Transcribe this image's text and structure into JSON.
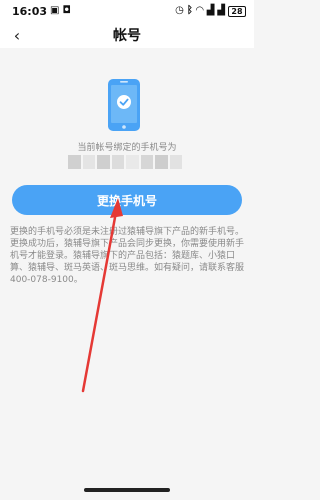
{
  "status_bar": {
    "time": "16:03",
    "battery": "28",
    "icons": [
      "notification-icon",
      "chat-bubble-icon",
      "alarm-icon",
      "bluetooth-icon",
      "wifi-icon",
      "signal-icon",
      "signal-icon",
      "battery-icon"
    ]
  },
  "nav": {
    "back_label": "‹",
    "title": "帐号"
  },
  "main": {
    "bind_label": "当前帐号绑定的手机号为",
    "masked_phone_colors": [
      "#d0d0d0",
      "#e4e4e4",
      "#cfcfcf",
      "#dcdcdc",
      "#e9e9e9",
      "#d6d6d6",
      "#cdcdcd",
      "#e2e2e2"
    ],
    "change_button_label": "更换手机号",
    "notice_text": "更换的手机号必须是未注册过猿辅导旗下产品的新手机号。更换成功后，猿辅导旗下产品会同步更换，你需要使用新手机号才能登录。猿辅导旗下的产品包括：猿题库、小猿口算、猿辅导、斑马英语、斑马思维。如有疑问，请联系客服400-078-9100。"
  },
  "colors": {
    "accent": "#4aa3f5",
    "arrow": "#e53935",
    "background": "#f5f5f5"
  }
}
